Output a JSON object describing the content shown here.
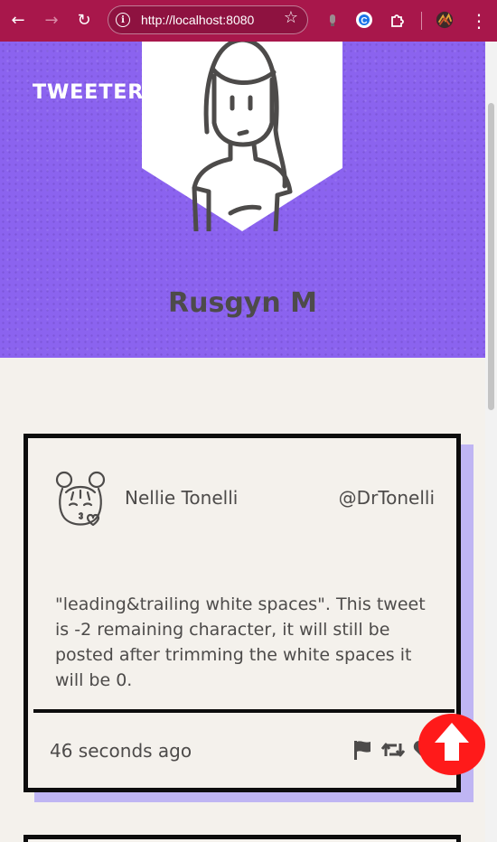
{
  "browser": {
    "url": "http://localhost:8080",
    "colors": {
      "toolbar": "#a8174b"
    }
  },
  "header": {
    "brand": "TWEETER",
    "user_name": "Rusgyn M",
    "colors": {
      "background": "#8b63ef"
    }
  },
  "tweet": {
    "author_name": "Nellie Tonelli",
    "author_handle": "@DrTonelli",
    "text": "\"leading&trailing white spaces\". This tweet is -2 remaining character, it will still be posted after trimming the white spaces it will be 0.",
    "time_ago": "46 seconds ago",
    "actions": [
      "flag-icon",
      "retweet-icon",
      "heart-icon"
    ]
  },
  "scroll_top": {
    "icon": "arrow-up-icon",
    "color": "#ff1a1a"
  }
}
